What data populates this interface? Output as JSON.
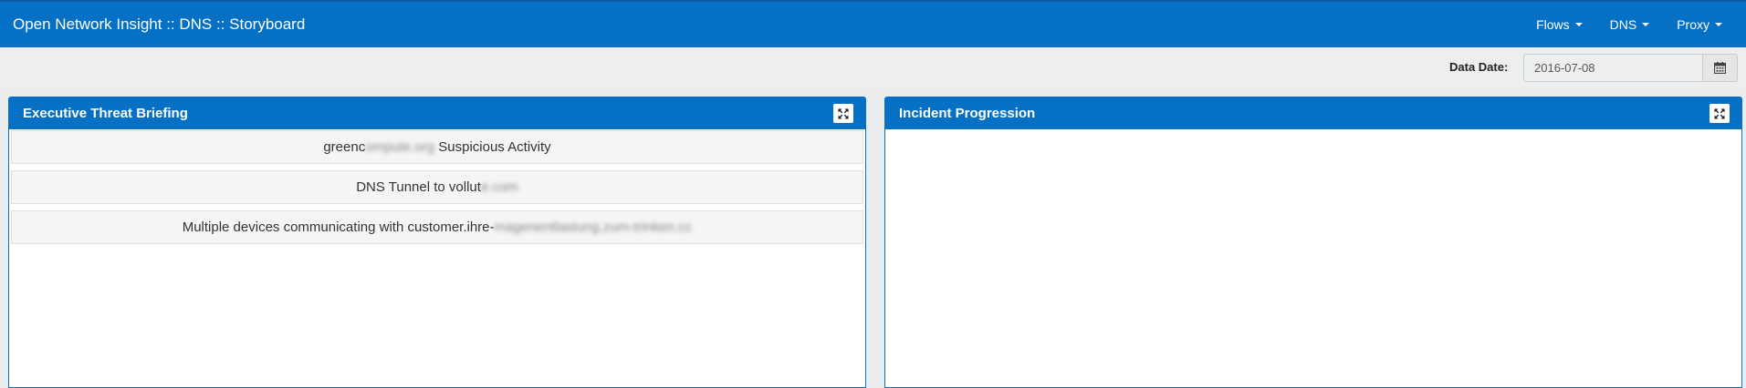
{
  "app": {
    "title": "Open Network Insight :: DNS :: Storyboard"
  },
  "nav": {
    "items": [
      {
        "label": "Flows"
      },
      {
        "label": "DNS"
      },
      {
        "label": "Proxy"
      }
    ]
  },
  "date_filter": {
    "label": "Data Date:",
    "value": "2016-07-08",
    "button_icon": "calendar-icon"
  },
  "panels": {
    "executive": {
      "title": "Executive Threat Briefing",
      "expand_icon": "expand-icon",
      "items": [
        {
          "prefix": "greenc",
          "hidden": "ompute.org",
          "suffix": " Suspicious Activity"
        },
        {
          "prefix": "DNS Tunnel to vollut",
          "hidden": "e.com",
          "suffix": ""
        },
        {
          "prefix": "Multiple devices communicating with customer.ihre-",
          "hidden": "magenentlastung.zum-trinken.cc",
          "suffix": ""
        }
      ]
    },
    "incident": {
      "title": "Incident Progression",
      "expand_icon": "expand-icon"
    }
  },
  "colors": {
    "primary": "#0670c4",
    "page_background": "#eaecee",
    "list_item_background": "#f5f5f5"
  }
}
